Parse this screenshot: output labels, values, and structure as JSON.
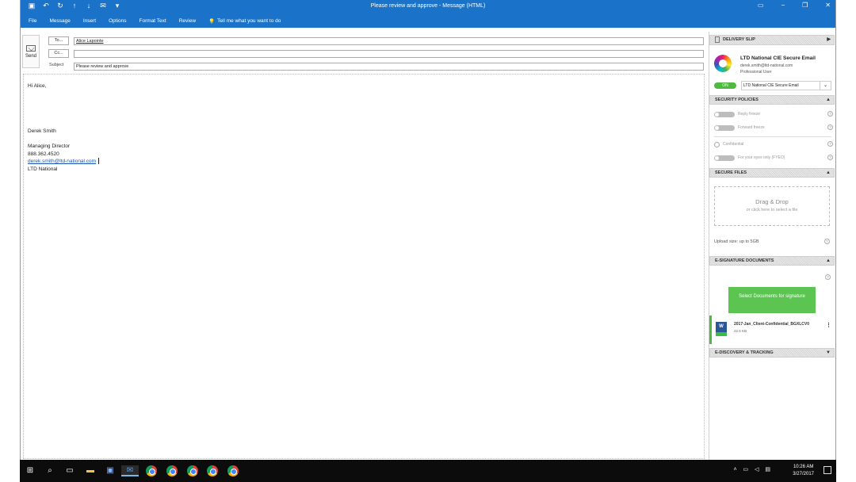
{
  "window": {
    "title": "Please review and approve  -  Message (HTML)"
  },
  "ribbon": {
    "tabs": [
      "File",
      "Message",
      "Insert",
      "Options",
      "Format Text",
      "Review"
    ],
    "tell_me": "Tell me what you want to do"
  },
  "compose": {
    "send_label": "Send",
    "to_label": "To...",
    "cc_label": "Cc...",
    "subject_label": "Subject",
    "to_value": "Alice Lapointe",
    "cc_value": "",
    "subject_value": "Please review and approve"
  },
  "body": {
    "greeting": "Hi Alice,",
    "sig_name": "Derek Smith",
    "sig_title": "Managing Director",
    "sig_phone": "888.362.4520",
    "sig_email": "derek.smith@ltd-national.com",
    "sig_company": "LTD National"
  },
  "panel": {
    "delivery_slip": "DELIVERY SLIP",
    "account_name": "LTD National CIE Secure Email",
    "account_email": "derek.smith@ltd-national.com",
    "account_role": "Professional User",
    "on_label": "ON",
    "account_select": "LTD National CIE Secure Email",
    "security_header": "SECURITY POLICIES",
    "policies": [
      "Reply freeze",
      "Forward freeze",
      "Confidential",
      "For your eyes only (FYEO)"
    ],
    "files_header": "SECURE FILES",
    "drag_title": "Drag & Drop",
    "drag_sub": "or click here to select a file",
    "upload_size": "Upload size: up to 5GB",
    "esig_header": "E-SIGNATURE DOCUMENTS",
    "sig_button": "Select Documents for signature",
    "doc_name": "2017-Jan_Client-Confidential_BGXLCV0",
    "doc_size": "22.5 KB",
    "ediscovery_header": "E-DISCOVERY & TRACKING"
  },
  "taskbar": {
    "time": "10:26 AM",
    "date": "3/27/2017"
  }
}
